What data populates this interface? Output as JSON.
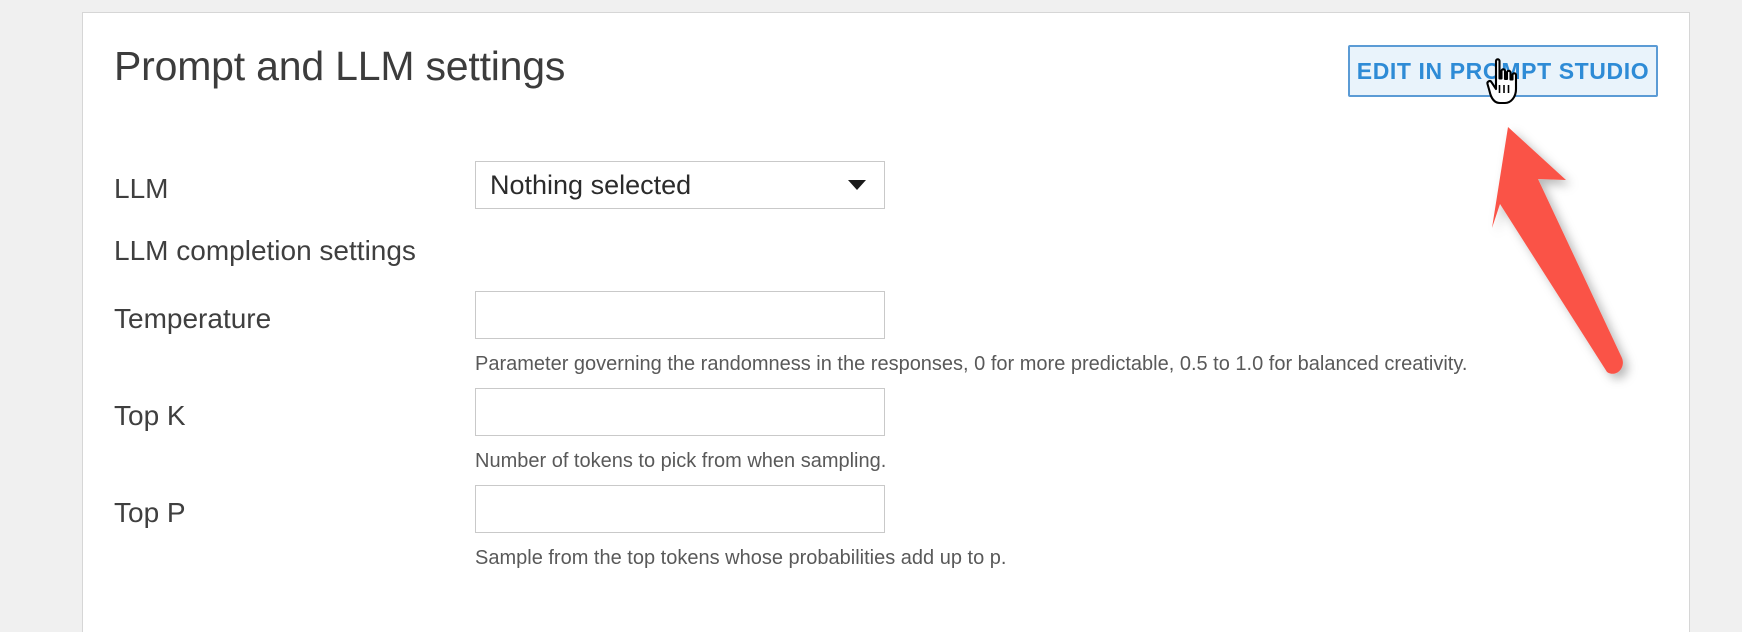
{
  "page": {
    "background_color": "#f0f0f0",
    "panel_background": "#ffffff"
  },
  "header": {
    "title": "Prompt and LLM settings",
    "edit_button_label": "EDIT IN PROMPT STUDIO",
    "edit_button_text_color": "#2e8bd6",
    "edit_button_border_color": "#5b9bd5",
    "edit_button_fill_color": "#e9f3fb"
  },
  "form": {
    "llm": {
      "label": "LLM",
      "selected_value": "Nothing selected",
      "caret_icon": "chevron-down-icon"
    },
    "section_title": "LLM completion settings",
    "fields": [
      {
        "label": "Temperature",
        "value": "",
        "placeholder": "",
        "help": "Parameter governing the randomness in the responses, 0 for more predictable, 0.5 to 1.0 for balanced creativity."
      },
      {
        "label": "Top K",
        "value": "",
        "placeholder": "",
        "help": "Number of tokens to pick from when sampling."
      },
      {
        "label": "Top P",
        "value": "",
        "placeholder": "",
        "help": "Sample from the top tokens whose probabilities add up to p."
      }
    ]
  },
  "annotation": {
    "arrow_color": "#fa5347",
    "arrow_description": "red-arrow-pointing-to-edit-in-prompt-studio-button",
    "cursor_icon": "pointing-hand-cursor"
  }
}
